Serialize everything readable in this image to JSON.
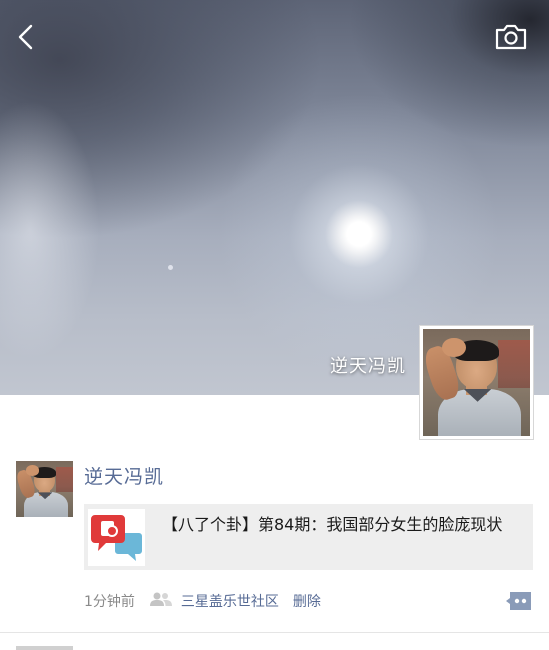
{
  "header": {
    "back_icon": "chevron-left-icon",
    "camera_icon": "camera-icon"
  },
  "profile": {
    "name": "逆天冯凯"
  },
  "post": {
    "author": "逆天冯凯",
    "link_card": {
      "title": "【八了个卦】第84期：我国部分女生的脸庞现状",
      "thumbnail_icon": "chat-bubbles-logo-icon"
    },
    "time": "1分钟前",
    "visibility_icon": "people-icon",
    "location": "三星盖乐世社区",
    "delete_label": "删除",
    "comment_icon": "comment-dots-icon"
  },
  "colors": {
    "link_blue": "#576b95",
    "card_bg": "#eeeeee",
    "meta_gray": "#8a8a8a"
  }
}
